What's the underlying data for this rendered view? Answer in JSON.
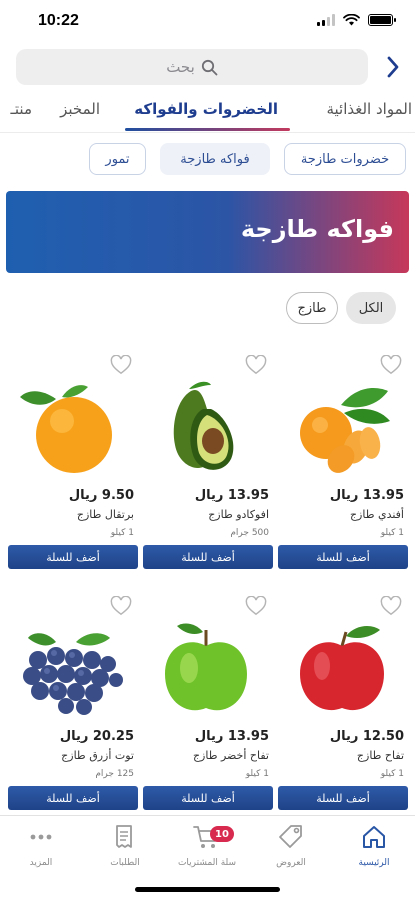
{
  "status": {
    "time": "10:22"
  },
  "search": {
    "placeholder": "بحث"
  },
  "tabs": [
    {
      "label": "المواد الغذائية",
      "active": false
    },
    {
      "label": "الخضروات والفواكه",
      "active": true
    },
    {
      "label": "المخبز",
      "active": false
    },
    {
      "label": "منتـ",
      "active": false
    }
  ],
  "subcategories": [
    {
      "label": "خضروات طازجة",
      "active": false
    },
    {
      "label": "فواكه طازجة",
      "active": true
    },
    {
      "label": "تمور",
      "active": false
    }
  ],
  "banner": {
    "title": "فواكه طازجة"
  },
  "filters": {
    "all": "الكل",
    "fresh": "طازج"
  },
  "add_label": "أضف للسلة",
  "products": [
    {
      "price": "13.95 ريال",
      "name": "أفندي طازج",
      "weight": "1 كيلو",
      "image": "tangerine"
    },
    {
      "price": "13.95 ريال",
      "name": "افوكادو طازج",
      "weight": "500 جرام",
      "image": "avocado"
    },
    {
      "price": "9.50 ريال",
      "name": "برتقال طازج",
      "weight": "1 كيلو",
      "image": "orange"
    },
    {
      "price": "12.50 ريال",
      "name": "تفاح طازج",
      "weight": "1 كيلو",
      "image": "red-apple"
    },
    {
      "price": "13.95 ريال",
      "name": "تفاح أخضر طازج",
      "weight": "1 كيلو",
      "image": "green-apple"
    },
    {
      "price": "20.25 ريال",
      "name": "توت أزرق طازج",
      "weight": "125 جرام",
      "image": "blueberries"
    }
  ],
  "nav": {
    "home": "الرئيسية",
    "offers": "العروض",
    "cart": "سلة المشتريات",
    "cart_count": "10",
    "orders": "الطلبات",
    "more": "المزيد"
  },
  "colors": {
    "accent": "#2a56a6",
    "badge": "#d8294e",
    "banner_start": "#1f5fb0",
    "banner_end": "#c6385a"
  }
}
